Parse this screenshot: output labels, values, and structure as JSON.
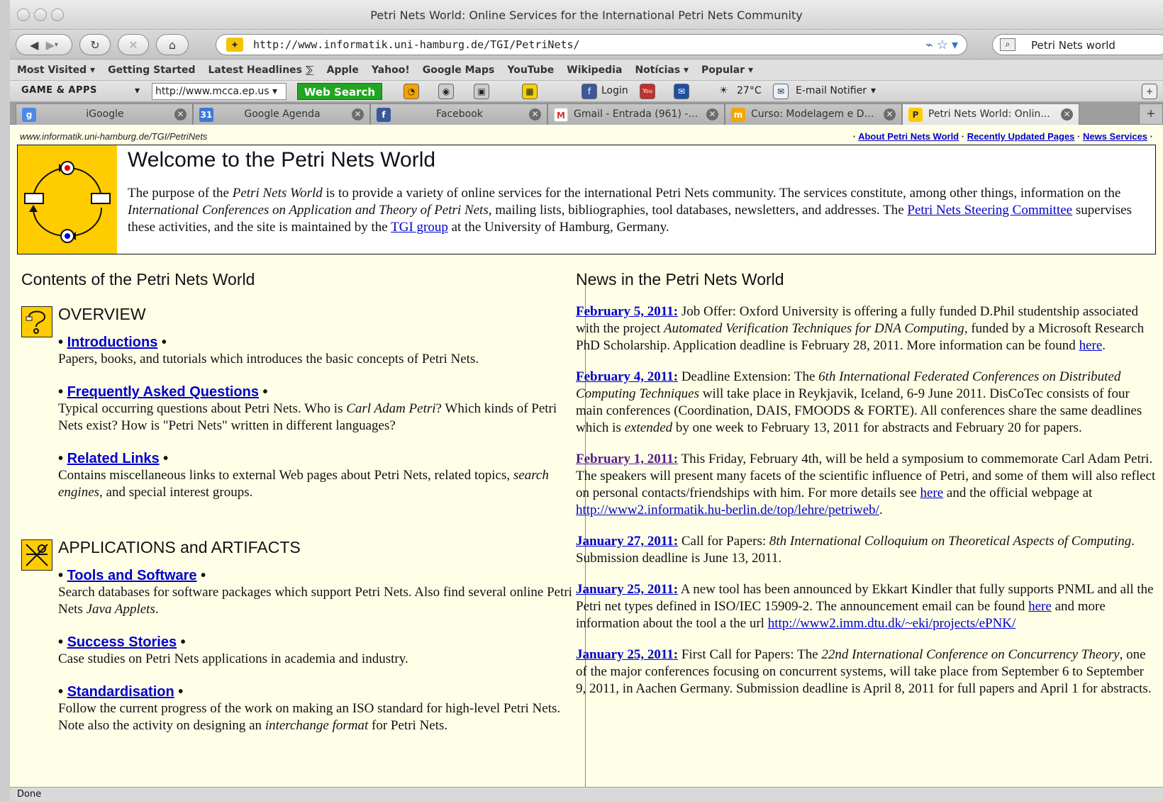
{
  "window": {
    "title": "Petri Nets World: Online Services for the International Petri Nets Community"
  },
  "navbar": {
    "back_icon": "back-arrow-icon",
    "forward_icon": "forward-arrow-icon",
    "reload_icon": "reload-icon",
    "stop_icon": "stop-icon",
    "home_icon": "home-icon",
    "url": "http://www.informatik.uni-hamburg.de/TGI/PetriNets/",
    "search_value": "Petri Nets world"
  },
  "bookmarks": [
    "Most Visited ▾",
    "Getting Started",
    "Latest Headlines ⅀",
    "Apple",
    "Yahoo!",
    "Google Maps",
    "YouTube",
    "Wikipedia",
    "Notícias ▾",
    "Popular ▾"
  ],
  "addonbar": {
    "brand": "GAME & APPS",
    "url_value": "http://www.mcca.ep.us",
    "web_search_label": "Web Search",
    "login_label": "Login",
    "weather": "27°C",
    "email_notifier": "E-mail Notifier"
  },
  "tabs": [
    {
      "label": "iGoogle",
      "fav": "g"
    },
    {
      "label": "Google Agenda",
      "fav": "31"
    },
    {
      "label": "Facebook",
      "fav": "f"
    },
    {
      "label": "Gmail - Entrada (961) - ...",
      "fav": "M"
    },
    {
      "label": "Curso: Modelagem e De...",
      "fav": "m"
    },
    {
      "label": "Petri Nets World: Onlin...",
      "fav": "P"
    }
  ],
  "page": {
    "path": "www.informatik.uni-hamburg.de/TGI/PetriNets",
    "top_links": [
      "About Petri Nets World",
      "Recently Updated Pages",
      "News Services"
    ],
    "welcome_title": "Welcome to the Petri Nets World",
    "welcome": {
      "p1": "The purpose of the ",
      "em1": "Petri Nets World",
      "p2": " is to provide a variety of online services for the international Petri Nets community. The services constitute, among other things, information on the ",
      "em2": "International Conferences on Application and Theory of Petri Nets",
      "p3": ", mailing lists, bibliographies, tool databases, newsletters, and addresses. The ",
      "link1": "Petri Nets Steering Committee",
      "p4": " supervises these activities, and the site is maintained by the ",
      "link2": "TGI group",
      "p5": " at the University of Hamburg, Germany."
    },
    "contents_heading": "Contents of the Petri Nets World",
    "news_heading": "News in the Petri Nets World",
    "overview": {
      "title": "OVERVIEW",
      "items": [
        {
          "link": "Introductions",
          "text": "Papers, books, and tutorials which introduces the basic concepts of Petri Nets."
        },
        {
          "link": "Frequently Asked Questions",
          "text_a": "Typical occurring questions about Petri Nets. Who is ",
          "text_em": "Carl Adam Petri",
          "text_b": "? Which kinds of Petri Nets exist? How is \"Petri Nets\" written in different languages?"
        },
        {
          "link": "Related Links",
          "text_a": "Contains miscellaneous links to external Web pages about Petri Nets, related topics, ",
          "text_em": "search engines",
          "text_b": ", and special interest groups."
        }
      ]
    },
    "applications": {
      "title": "APPLICATIONS and ARTIFACTS",
      "items": [
        {
          "link": "Tools and Software",
          "text_a": "Search databases for software packages which support Petri Nets. Also find several online Petri Nets ",
          "text_em": "Java Applets",
          "text_b": "."
        },
        {
          "link": "Success Stories",
          "text": "Case studies on Petri Nets applications in academia and industry."
        },
        {
          "link": "Standardisation",
          "text_a": "Follow the current progress of the work on making an ISO standard for high-level Petri Nets. Note also the activity on designing an ",
          "text_em": "interchange format",
          "text_b": " for Petri Nets."
        }
      ]
    },
    "news": [
      {
        "date": "February 5, 2011:",
        "a": " Job Offer: Oxford University is offering a fully funded D.Phil studentship associated with the project ",
        "em": "Automated Verification Techniques for DNA Computing",
        "b": ", funded by a Microsoft Research PhD Scholarship. Application deadline is February 28, 2011. More information can be found ",
        "link": "here",
        "c": "."
      },
      {
        "date": "February 4, 2011:",
        "a": " Deadline Extension: The ",
        "em": "6th International Federated Conferences on Distributed Computing Techniques",
        "b": " will take place in Reykjavik, Iceland, 6-9 June 2011. DisCoTec consists of four main conferences (Coordination, DAIS, FMOODS & FORTE). All conferences share the same deadlines which is ",
        "em2": "extended",
        "c": " by one week to February 13, 2011 for abstracts and February 20 for papers."
      },
      {
        "date": "February 1, 2011:",
        "a": " This Friday, February 4th, will be held a symposium to commemorate Carl Adam Petri. The speakers will present many facets of the scientific influence of Petri, and some of them will also reflect on personal contacts/friendships with him. For more details see ",
        "link": "here",
        "b": " and the official webpage at ",
        "link2": "http://www2.informatik.hu-berlin.de/top/lehre/petriweb/",
        "c": "."
      },
      {
        "date": "January 27, 2011:",
        "a": " Call for Papers: ",
        "em": "8th International Colloquium on Theoretical Aspects of Computing",
        "b": ". Submission deadline is June 13, 2011."
      },
      {
        "date": "January 25, 2011:",
        "a": " A new tool has been announced by Ekkart Kindler that fully supports PNML and all the Petri net types defined in ISO/IEC 15909-2. The announcement email can be found ",
        "link": "here",
        "b": " and more information about the tool a the url ",
        "link2": "http://www2.imm.dtu.dk/~eki/projects/ePNK/"
      },
      {
        "date": "January 25, 2011:",
        "a": " First Call for Papers: The ",
        "em": "22nd International Conference on Concurrency Theory",
        "b": ", one of the major conferences focusing on concurrent systems, will take place from September 6 to September 9, 2011, in Aachen Germany. Submission deadline is April 8, 2011 for full papers and April 1 for abstracts."
      }
    ]
  },
  "status": "Done",
  "colors": {
    "link": "#0000cc",
    "visited": "#551a8b",
    "page_bg": "#ffffe8",
    "accent": "#ffcc00"
  }
}
